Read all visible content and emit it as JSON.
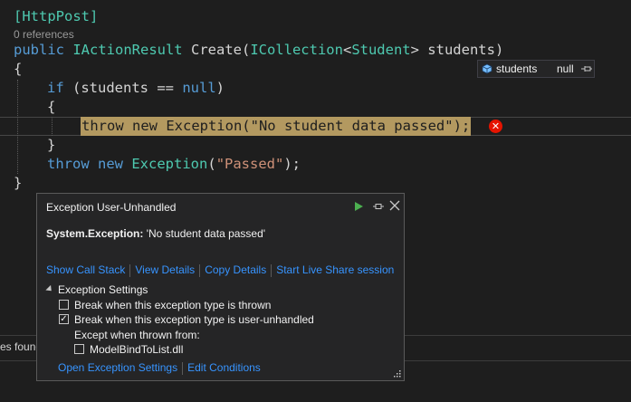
{
  "editor": {
    "attribute": "[HttpPost]",
    "references": "0 references",
    "sig_public": "public ",
    "sig_return": "IActionResult",
    "sig_name": " Create(",
    "sig_coll": "ICollection",
    "sig_lt": "<",
    "sig_student": "Student",
    "sig_rest": "> students)",
    "open_brace": "{",
    "if_kw": "if",
    "if_cond_open": " (students == ",
    "if_null": "null",
    "if_cond_close": ")",
    "inner_open": "{",
    "highlight_line": "throw new Exception(\"No student data passed\");",
    "inner_close": "}",
    "throw_kw": "throw",
    "new_kw": " new ",
    "exc_type": "Exception",
    "paren_open": "(",
    "passed_str": "\"Passed\"",
    "paren_close": ");",
    "close_brace": "}"
  },
  "datatip": {
    "name": "students",
    "value": "null"
  },
  "bottom_panel": {
    "text": "es found"
  },
  "exception_popup": {
    "title": "Exception User-Unhandled",
    "exception_type": "System.Exception:",
    "exception_message": "'No student data passed'",
    "links": {
      "call_stack": "Show Call Stack",
      "view_details": "View Details",
      "copy_details": "Copy Details",
      "live_share": "Start Live Share session"
    },
    "settings_header": "Exception Settings",
    "options": [
      {
        "label": "Break when this exception type is thrown",
        "checked": false
      },
      {
        "label": "Break when this exception type is user-unhandled",
        "checked": true
      }
    ],
    "except_label": "Except when thrown from:",
    "module": {
      "label": "ModelBindToList.dll",
      "checked": false
    },
    "bottom_links": {
      "open_settings": "Open Exception Settings",
      "edit_conditions": "Edit Conditions"
    }
  },
  "colors": {
    "keyword": "#569cd6",
    "type": "#4ec9b0",
    "string": "#ce9178",
    "link": "#3794ff",
    "highlight": "#b39960",
    "error": "#e51400",
    "run": "#4caf50"
  }
}
